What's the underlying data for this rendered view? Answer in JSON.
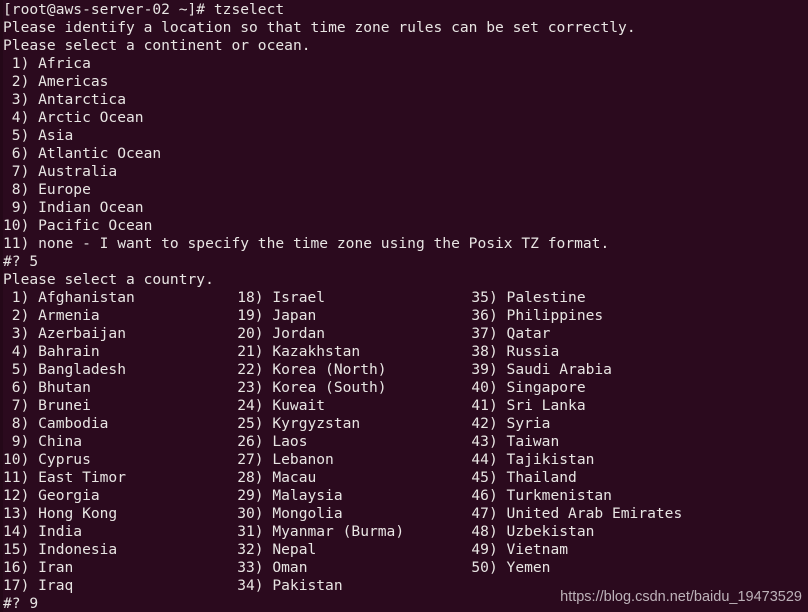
{
  "terminal": {
    "background_color": "#2b0a1e",
    "text_color": "#e8e5e3",
    "prompt_line": "[root@aws-server-02 ~]# tzselect",
    "intro_line_1": "Please identify a location so that time zone rules can be set correctly.",
    "intro_line_2": "Please select a continent or ocean.",
    "continents": [
      " 1) Africa",
      " 2) Americas",
      " 3) Antarctica",
      " 4) Arctic Ocean",
      " 5) Asia",
      " 6) Atlantic Ocean",
      " 7) Australia",
      " 8) Europe",
      " 9) Indian Ocean",
      "10) Pacific Ocean",
      "11) none - I want to specify the time zone using the Posix TZ format."
    ],
    "continent_prompt": "#? 5",
    "country_prompt_line": "Please select a country.",
    "country_rows": [
      [
        " 1) Afghanistan",
        "18) Israel",
        "35) Palestine"
      ],
      [
        " 2) Armenia",
        "19) Japan",
        "36) Philippines"
      ],
      [
        " 3) Azerbaijan",
        "20) Jordan",
        "37) Qatar"
      ],
      [
        " 4) Bahrain",
        "21) Kazakhstan",
        "38) Russia"
      ],
      [
        " 5) Bangladesh",
        "22) Korea (North)",
        "39) Saudi Arabia"
      ],
      [
        " 6) Bhutan",
        "23) Korea (South)",
        "40) Singapore"
      ],
      [
        " 7) Brunei",
        "24) Kuwait",
        "41) Sri Lanka"
      ],
      [
        " 8) Cambodia",
        "25) Kyrgyzstan",
        "42) Syria"
      ],
      [
        " 9) China",
        "26) Laos",
        "43) Taiwan"
      ],
      [
        "10) Cyprus",
        "27) Lebanon",
        "44) Tajikistan"
      ],
      [
        "11) East Timor",
        "28) Macau",
        "45) Thailand"
      ],
      [
        "12) Georgia",
        "29) Malaysia",
        "46) Turkmenistan"
      ],
      [
        "13) Hong Kong",
        "30) Mongolia",
        "47) United Arab Emirates"
      ],
      [
        "14) India",
        "31) Myanmar (Burma)",
        "48) Uzbekistan"
      ],
      [
        "15) Indonesia",
        "32) Nepal",
        "49) Vietnam"
      ],
      [
        "16) Iran",
        "33) Oman",
        "50) Yemen"
      ],
      [
        "17) Iraq",
        "34) Pakistan",
        ""
      ]
    ],
    "country_prompt": "#? 9"
  },
  "watermark": {
    "text": "https://blog.csdn.net/baidu_19473529"
  }
}
